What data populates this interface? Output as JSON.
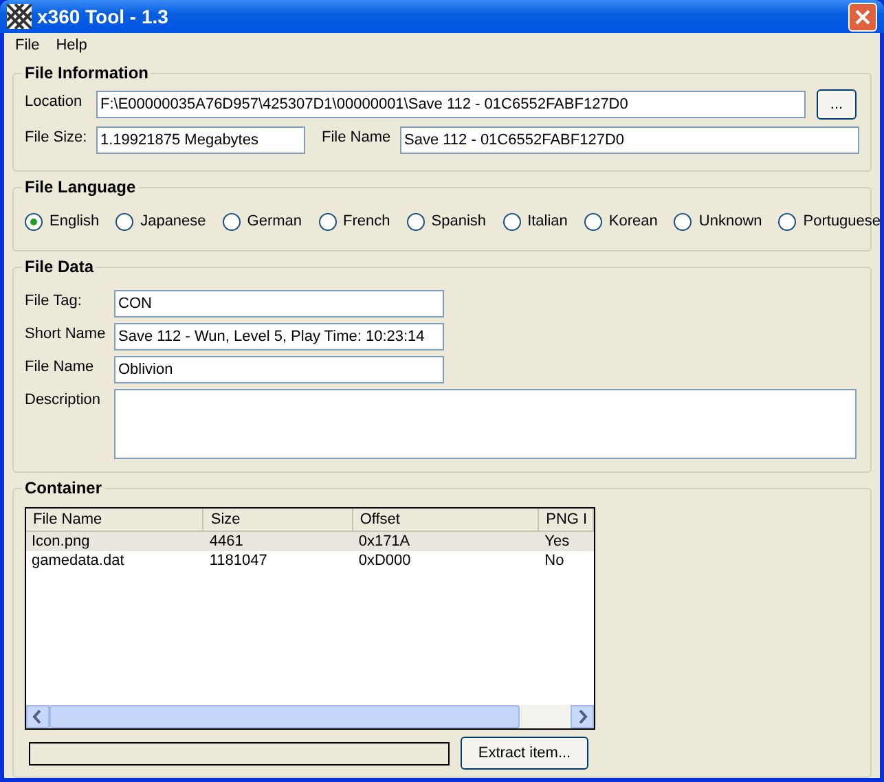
{
  "window": {
    "title": "x360 Tool - 1.3"
  },
  "menu": [
    "File",
    "Help"
  ],
  "file_information": {
    "title": "File Information",
    "location_label": "Location",
    "location": "F:\\E00000035A76D957\\425307D1\\00000001\\Save 112 - 01C6552FABF127D0",
    "browse": "...",
    "size_label": "File Size:",
    "size": "1.19921875 Megabytes",
    "name_label": "File Name",
    "name": "Save 112 - 01C6552FABF127D0"
  },
  "file_language": {
    "title": "File Language",
    "options": [
      {
        "label": "English",
        "selected": true
      },
      {
        "label": "Japanese",
        "selected": false
      },
      {
        "label": "German",
        "selected": false
      },
      {
        "label": "French",
        "selected": false
      },
      {
        "label": "Spanish",
        "selected": false
      },
      {
        "label": "Italian",
        "selected": false
      },
      {
        "label": "Korean",
        "selected": false
      },
      {
        "label": "Unknown",
        "selected": false
      },
      {
        "label": "Portuguese",
        "selected": false
      }
    ]
  },
  "file_data": {
    "title": "File Data",
    "fields": [
      {
        "label": "File Tag:",
        "value": "CON",
        "kind": "short"
      },
      {
        "label": "Short Name",
        "value": "Save 112 - Wun, Level 5, Play Time: 10:23:14",
        "kind": "short"
      },
      {
        "label": "File Name",
        "value": "Oblivion",
        "kind": "short"
      },
      {
        "label": "Description",
        "kind": "multiline"
      }
    ]
  },
  "container": {
    "title": "Container",
    "columns": [
      "File Name",
      "Size",
      "Offset",
      "PNG I"
    ],
    "rows": [
      {
        "cells": [
          "Icon.png",
          "4461",
          "0x171A",
          "Yes"
        ],
        "selected": true
      },
      {
        "cells": [
          "gamedata.dat",
          "1181047",
          "0xD000",
          "No"
        ],
        "selected": false
      }
    ],
    "progress": {
      "level": 0
    },
    "extract": "Extract item..."
  }
}
